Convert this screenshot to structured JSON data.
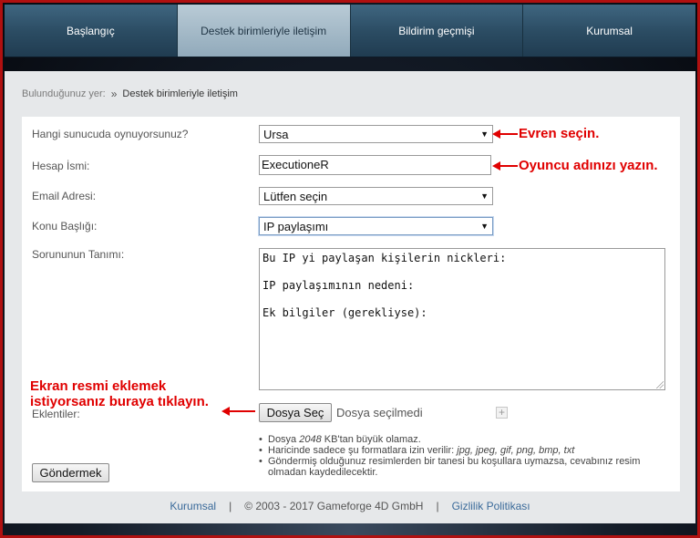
{
  "nav": {
    "tabs": [
      {
        "label": "Başlangıç"
      },
      {
        "label": "Destek birimleriyle iletişim"
      },
      {
        "label": "Bildirim geçmişi"
      },
      {
        "label": "Kurumsal"
      }
    ]
  },
  "breadcrumb": {
    "prefix": "Bulunduğunuz yer:",
    "separator": "»",
    "current": "Destek birimleriyle iletişim"
  },
  "form": {
    "server_label": "Hangi sunucuda oynuyorsunuz?",
    "server_value": "Ursa",
    "account_label": "Hesap İsmi:",
    "account_value": "ExecutioneR",
    "email_label": "Email Adresi:",
    "email_value": "Lütfen seçin",
    "subject_label": "Konu Başlığı:",
    "subject_value": "IP paylaşımı",
    "description_label": "Sorununun Tanımı:",
    "description_lines": [
      "Bu IP yi paylaşan kişilerin nickleri:",
      "",
      "IP paylaşımının nedeni:",
      "",
      "Ek bilgiler (gerekliyse):"
    ],
    "attachments_label": "Eklentiler:",
    "file_button": "Dosya Seç",
    "file_status": "Dosya seçilmedi",
    "rules": {
      "bullet": "•",
      "r1_pre": "Dosya ",
      "r1_size": "2048",
      "r1_post": " KB'tan büyük olamaz.",
      "r2_pre": "Haricinde sadece şu formatlara izin verilir: ",
      "r2_formats": "jpg, jpeg, gif, png, bmp, txt",
      "r3": "Göndermiş olduğunuz resimlerden bir tanesi bu koşullara uymazsa, cevabınız resim olmadan kaydedilecektir."
    },
    "submit": "Göndermek"
  },
  "footer": {
    "link1": "Kurumsal",
    "sep": "|",
    "copyright": "© 2003 - 2017 Gameforge 4D GmbH",
    "link2": "Gizlilik Politikası"
  },
  "annotations": {
    "server": "Evren seçin.",
    "account": "Oyuncu adınızı yazın.",
    "attach_line1": "Ekran resmi eklemek",
    "attach_line2": "istiyorsanız buraya tıklayın."
  },
  "colors": {
    "annotation": "#e00000",
    "frame": "#b01010"
  }
}
